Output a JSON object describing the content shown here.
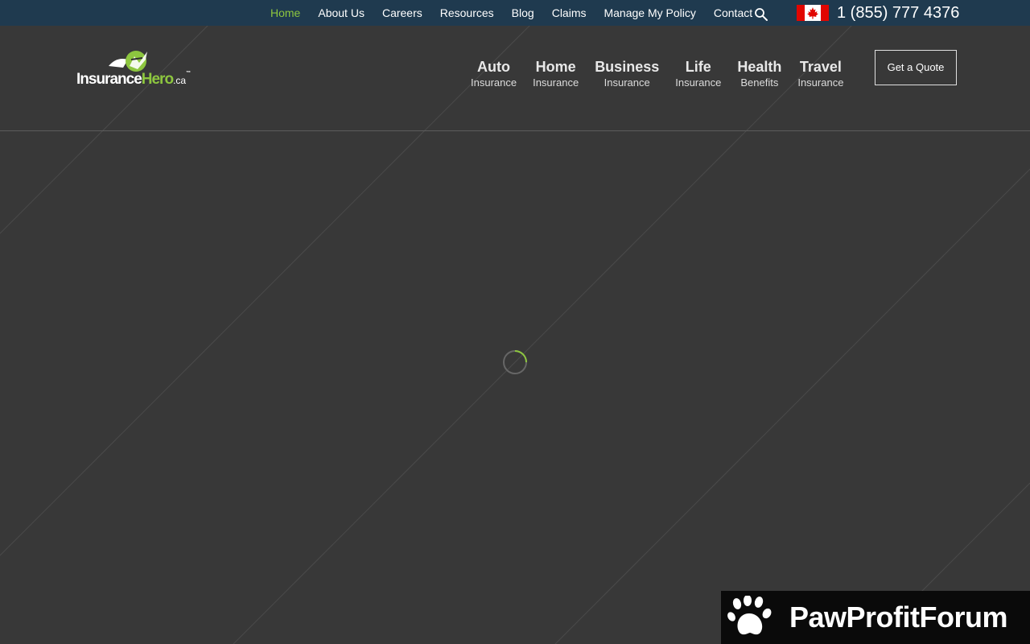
{
  "topbar": {
    "nav": [
      {
        "label": "Home",
        "active": true
      },
      {
        "label": "About Us"
      },
      {
        "label": "Careers"
      },
      {
        "label": "Resources"
      },
      {
        "label": "Blog"
      },
      {
        "label": "Claims"
      },
      {
        "label": "Manage My Policy"
      },
      {
        "label": "Contact"
      }
    ],
    "search_icon": "search-icon",
    "flag_icon": "canada-flag-icon",
    "phone": "1 (855) 777 4376"
  },
  "logo": {
    "part1": "Insurance",
    "part2": "Hero",
    "part3": ".ca",
    "tm": "™"
  },
  "mainnav": [
    {
      "title": "Auto",
      "subtitle": "Insurance"
    },
    {
      "title": "Home",
      "subtitle": "Insurance"
    },
    {
      "title": "Business",
      "subtitle": "Insurance"
    },
    {
      "title": "Life",
      "subtitle": "Insurance"
    },
    {
      "title": "Health",
      "subtitle": "Benefits"
    },
    {
      "title": "Travel",
      "subtitle": "Insurance"
    }
  ],
  "quote_button": "Get a Quote",
  "banner": {
    "text": "PawProfitForum",
    "icon": "paw-icon"
  },
  "colors": {
    "topbar_bg": "#1f3a4f",
    "page_bg": "#383838",
    "accent": "#8dc63f",
    "flag_red": "#e10600"
  }
}
